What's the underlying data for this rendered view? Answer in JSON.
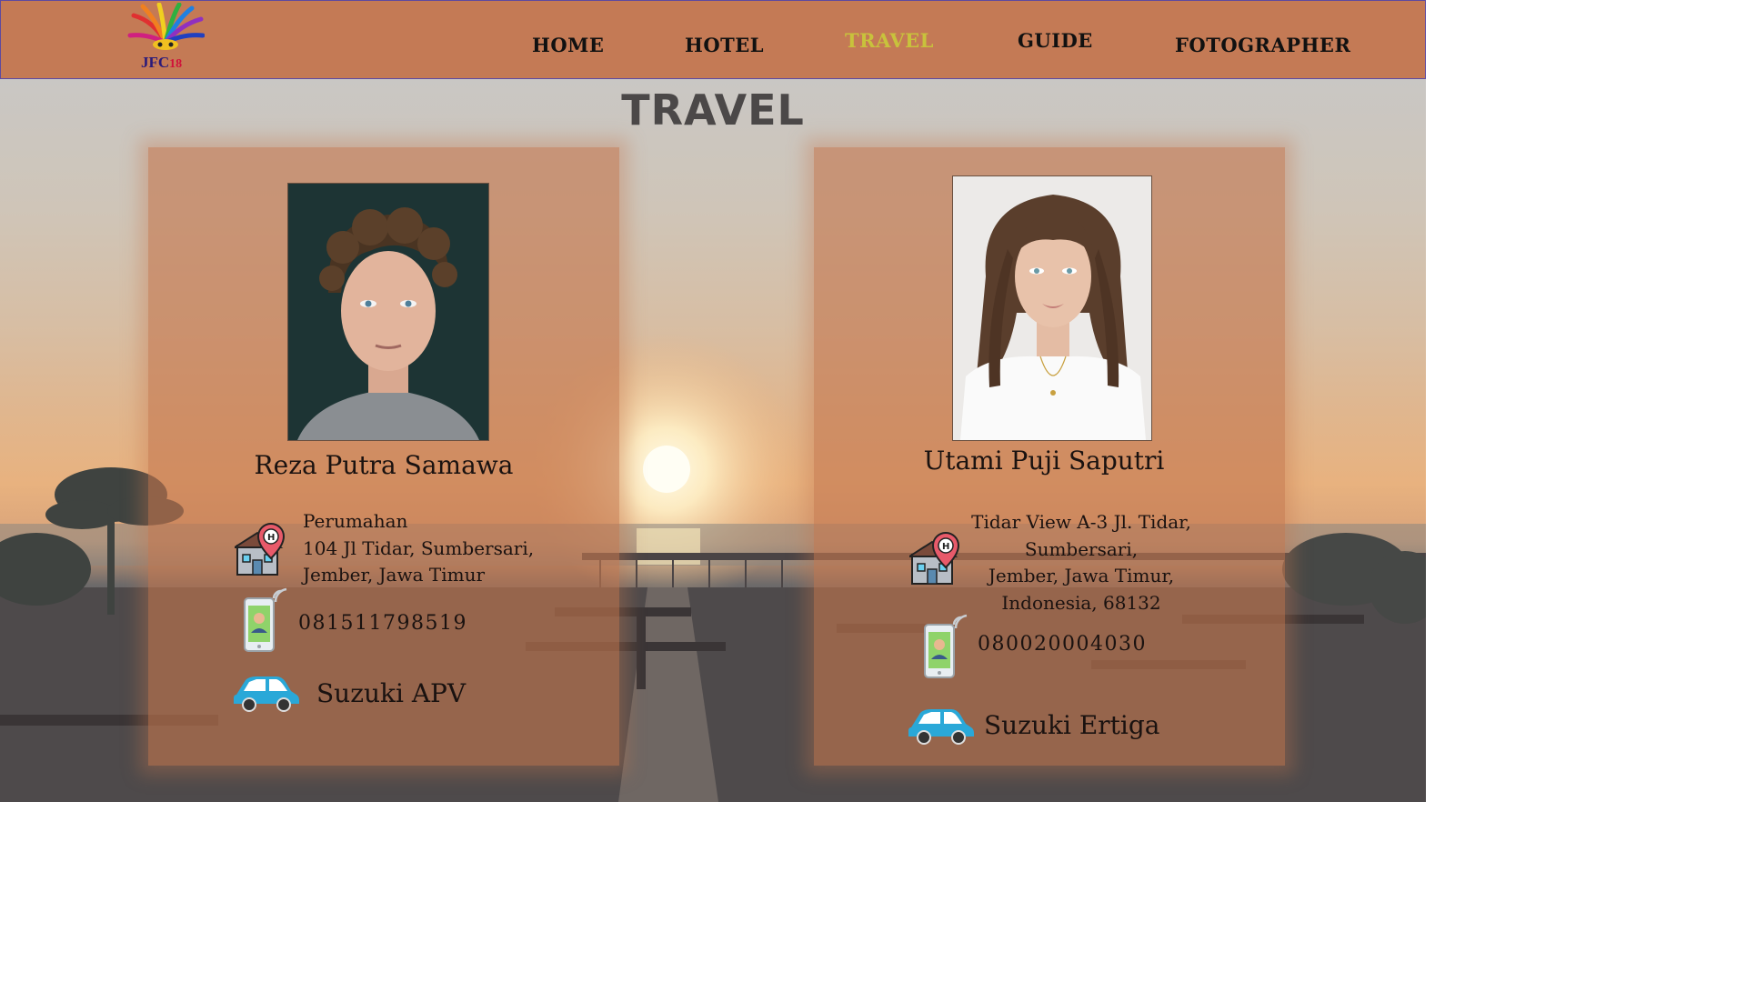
{
  "brand": {
    "logo_text": "JFC",
    "logo_number": "18"
  },
  "nav": {
    "items": [
      {
        "label": "HOME",
        "active": false
      },
      {
        "label": "HOTEL",
        "active": false
      },
      {
        "label": "TRAVEL",
        "active": true
      },
      {
        "label": "GUIDE",
        "active": false
      },
      {
        "label": "FOTOGRAPHER",
        "active": false
      }
    ],
    "active_color": "#c8c23c",
    "bar_color": "#c47a55"
  },
  "page": {
    "title": "TRAVEL"
  },
  "travel_agents": [
    {
      "name": "Reza Putra Samawa",
      "address_lines": [
        "Perumahan",
        "104 Jl Tidar, Sumbersari,",
        "Jember, Jawa Timur"
      ],
      "phone": "081511798519",
      "vehicle": "Suzuki APV"
    },
    {
      "name": "Utami Puji Saputri",
      "address_lines": [
        "Tidar View A-3 Jl. Tidar,",
        "Sumbersari,",
        "Jember, Jawa Timur,",
        "Indonesia, 68132"
      ],
      "phone": "080020004030",
      "vehicle": "Suzuki Ertiga"
    }
  ],
  "icons": {
    "address": "hotel-location-icon",
    "phone": "smartphone-contact-icon",
    "vehicle": "car-icon"
  }
}
